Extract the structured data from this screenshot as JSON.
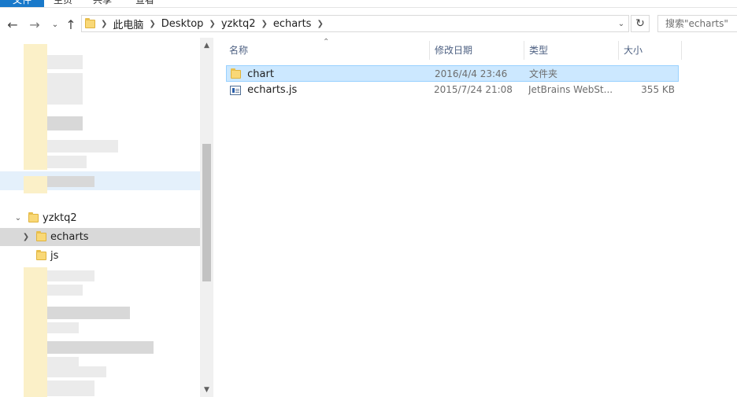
{
  "ribbon": {
    "tabs": [
      {
        "label": "文件"
      },
      {
        "label": "主页"
      },
      {
        "label": "共享"
      },
      {
        "label": "查看"
      }
    ]
  },
  "address": {
    "breadcrumbs": [
      "此电脑",
      "Desktop",
      "yzktq2",
      "echarts"
    ]
  },
  "search": {
    "placeholder": "搜索\"echarts\""
  },
  "nav": {
    "items": [
      {
        "label": "yzktq2"
      },
      {
        "label": "echarts"
      },
      {
        "label": "js"
      }
    ]
  },
  "columns": {
    "name": "名称",
    "date": "修改日期",
    "type": "类型",
    "size": "大小"
  },
  "files": [
    {
      "name": "chart",
      "date": "2016/4/4 23:46",
      "type": "文件夹",
      "size": "",
      "icon": "folder-icon"
    },
    {
      "name": "echarts.js",
      "date": "2015/7/24 21:08",
      "type": "JetBrains WebSt...",
      "size": "355 KB",
      "icon": "js-file-icon"
    }
  ],
  "colors": {
    "accent": "#1979ca",
    "selection": "#cce8ff",
    "folder": "#f9d877"
  }
}
